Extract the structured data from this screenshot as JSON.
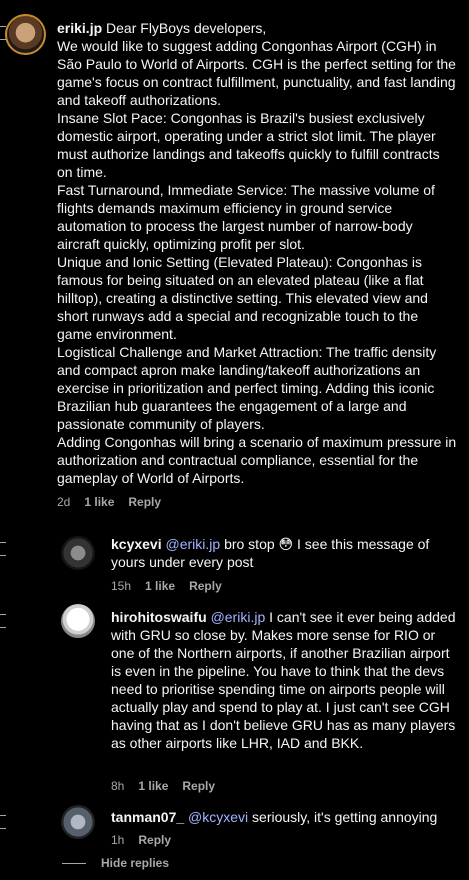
{
  "comments": [
    {
      "username": "eriki.jp",
      "lines": [
        "Dear FlyBoys developers,",
        "We would like to suggest adding Congonhas Airport (CGH) in São Paulo to World of Airports. CGH is the perfect setting for the game's focus on contract fulfillment, punctuality, and fast landing and takeoff authorizations.",
        "Insane Slot Pace: Congonhas is Brazil's busiest exclusively domestic airport, operating under a strict slot limit. The player must authorize landings and takeoffs quickly to fulfill contracts on time.",
        "Fast Turnaround, Immediate Service: The massive volume of flights demands maximum efficiency in ground service automation to process the largest number of narrow-body aircraft quickly, optimizing profit per slot.",
        "Unique and Ionic Setting (Elevated Plateau): Congonhas is famous for being situated on an elevated plateau (like a flat hilltop), creating a distinctive setting. This elevated view and short runways add a special and recognizable touch to the game environment.",
        "Logistical Challenge and Market Attraction: The traffic density and compact apron make landing/takeoff authorizations an exercise in prioritization and perfect timing. Adding this iconic Brazilian hub guarantees the engagement of a large and passionate community of players.",
        "Adding Congonhas will bring a scenario of maximum pressure in authorization and contractual compliance, essential for the gameplay of World of Airports."
      ],
      "time": "2d",
      "likes": "1 like",
      "reply": "Reply"
    },
    {
      "username": "kcyxevi",
      "mention": "@eriki.jp",
      "text": "bro stop 😳 I see this message of yours under every post",
      "time": "15h",
      "likes": "1 like",
      "reply": "Reply"
    },
    {
      "username": "hirohitoswaifu",
      "mention": "@eriki.jp",
      "text": "I can't see it ever being added with GRU so close by. Makes more sense for RIO or one of the Northern airports, if another Brazilian airport is even in the pipeline. You have to think that the devs need to prioritise spending time on airports people will actually play and spend to play at. I just can't see CGH having that as I don't believe GRU has as many players as other airports like LHR, IAD and BKK.",
      "time": "8h",
      "likes": "1 like",
      "reply": "Reply"
    },
    {
      "username": "tanman07_",
      "mention": "@kcyxevi",
      "text": "seriously, it's getting annoying",
      "time": "1h",
      "reply": "Reply"
    }
  ],
  "hide_replies": "Hide replies"
}
